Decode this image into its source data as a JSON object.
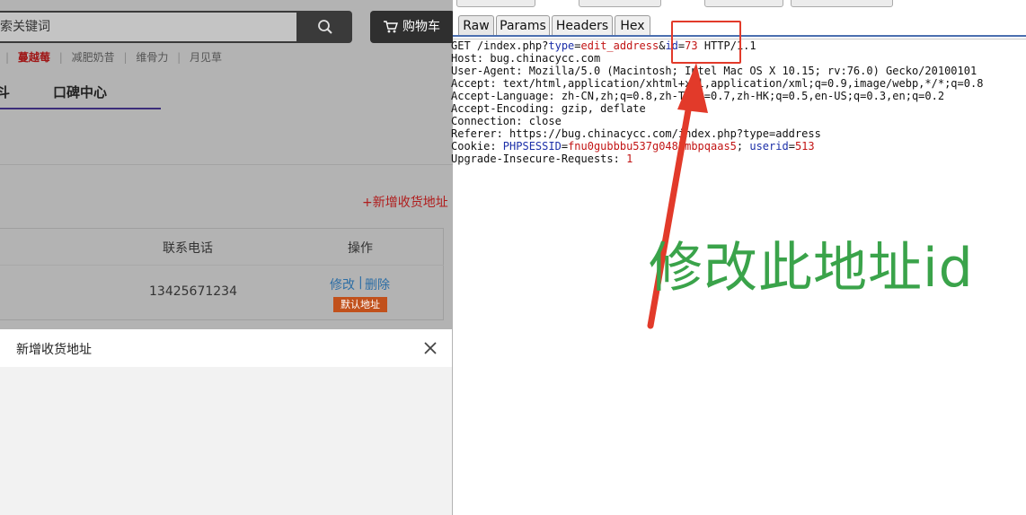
{
  "shop": {
    "search_placeholder": "索关键词",
    "cart_label": "购物车",
    "hot_words": [
      {
        "text": "蔓越莓",
        "highlight": true
      },
      {
        "text": "减肥奶昔",
        "highlight": false
      },
      {
        "text": "维骨力",
        "highlight": false
      },
      {
        "text": "月见草",
        "highlight": false
      }
    ],
    "tab_fragment": "斗",
    "tab_reviews": "口碑中心",
    "add_address": "+新增收货地址",
    "table": {
      "col_phone": "联系电话",
      "col_ops": "操作",
      "row_phone": "13425671234",
      "op_edit": "修改",
      "op_sep": "|",
      "op_delete": "删除",
      "default_badge": "默认地址"
    },
    "modal": {
      "title": "新增收货地址"
    }
  },
  "burp": {
    "tabs": [
      "Raw",
      "Params",
      "Headers",
      "Hex"
    ],
    "active_tab": "Raw",
    "request": {
      "line1_pre": "GET /index.php?",
      "line1_k1": "type",
      "line1_v1": "edit_address",
      "line1_amp": "&",
      "line1_k2": "id",
      "line1_v2": "73",
      "line1_post": " HTTP/1.1",
      "host": "Host: bug.chinacycc.com",
      "user_agent": "User-Agent: Mozilla/5.0 (Macintosh; Intel Mac OS X 10.15; rv:76.0) Gecko/20100101",
      "accept": "Accept: text/html,application/xhtml+xml,application/xml;q=0.9,image/webp,*/*;q=0.8",
      "accept_language": "Accept-Language: zh-CN,zh;q=0.8,zh-TW;q=0.7,zh-HK;q=0.5,en-US;q=0.3,en;q=0.2",
      "accept_encoding": "Accept-Encoding: gzip, deflate",
      "connection": "Connection: close",
      "referer": "Referer: https://bug.chinacycc.com/index.php?type=address",
      "cookie_pre": "Cookie: ",
      "cookie_k1": "PHPSESSID",
      "cookie_v1": "fnu0gubbbu537g0485mbpqaas5",
      "cookie_sep": "; ",
      "cookie_k2": "userid",
      "cookie_v2": "513",
      "upgrade_pre": "Upgrade-Insecure-Requests: ",
      "upgrade_val": "1"
    }
  },
  "annotation": {
    "text": "修改此地址id",
    "color": "#3aa34a",
    "arrow_color": "#e23a2a"
  }
}
